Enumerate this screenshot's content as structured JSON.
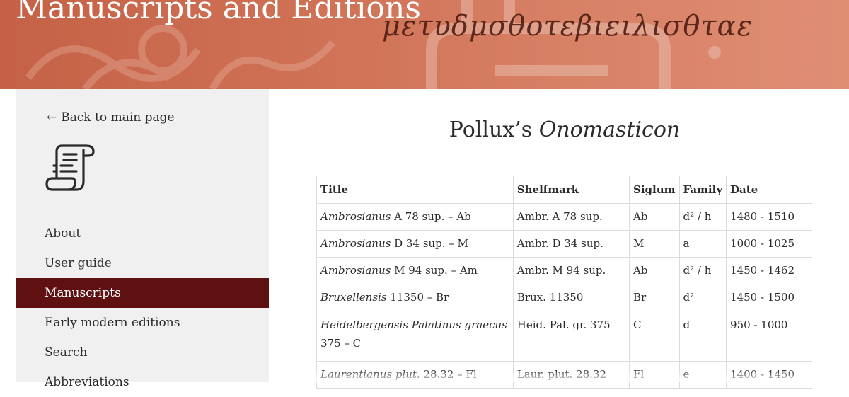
{
  "header": {
    "site_title": "Manuscripts and Editions",
    "banner_script": "μετυδμσθοτεβιειλισθταε"
  },
  "sidebar": {
    "back_link": "Back to main page",
    "items": [
      {
        "label": "About",
        "active": false
      },
      {
        "label": "User guide",
        "active": false
      },
      {
        "label": "Manuscripts",
        "active": true
      },
      {
        "label": "Early modern editions",
        "active": false
      },
      {
        "label": "Search",
        "active": false
      },
      {
        "label": "Abbreviations",
        "active": false
      }
    ]
  },
  "main": {
    "title_plain": "Pollux’s ",
    "title_italic": "Onomasticon",
    "table": {
      "headers": [
        "Title",
        "Shelfmark",
        "Siglum",
        "Family",
        "Date"
      ],
      "rows": [
        {
          "title_italic": "Ambrosianus",
          "title_rest": " A 78 sup. – Ab",
          "shelfmark": "Ambr. A 78 sup.",
          "siglum": "Ab",
          "family": "d² / h",
          "date": "1480 - 1510"
        },
        {
          "title_italic": "Ambrosianus",
          "title_rest": " D 34 sup. – M",
          "shelfmark": "Ambr. D 34 sup.",
          "siglum": "M",
          "family": "a",
          "date": "1000 - 1025"
        },
        {
          "title_italic": "Ambrosianus",
          "title_rest": " M 94 sup. – Am",
          "shelfmark": "Ambr. M 94 sup.",
          "siglum": "Ab",
          "family": "d² / h",
          "date": "1450 - 1462"
        },
        {
          "title_italic": "Bruxellensis",
          "title_rest": " 11350 – Br",
          "shelfmark": "Brux. 11350",
          "siglum": "Br",
          "family": "d²",
          "date": "1450 - 1500"
        },
        {
          "title_italic": "Heidelbergensis Palatinus graecus",
          "title_rest": " 375 – C",
          "shelfmark": "Heid. Pal. gr. 375",
          "siglum": "C",
          "family": "d",
          "date": "950 - 1000"
        },
        {
          "title_italic": "Laurentianus plut.",
          "title_rest": " 28.32 – Fl",
          "shelfmark": "Laur. plut. 28.32",
          "siglum": "Fl",
          "family": "e",
          "date": "1400 - 1450"
        }
      ]
    }
  },
  "colors": {
    "banner": "#d4775b",
    "active_nav": "#5f1111",
    "sidebar_bg": "#f0f0f0"
  },
  "icons": {
    "back": "arrow-left-icon",
    "logo": "scroll-icon"
  }
}
